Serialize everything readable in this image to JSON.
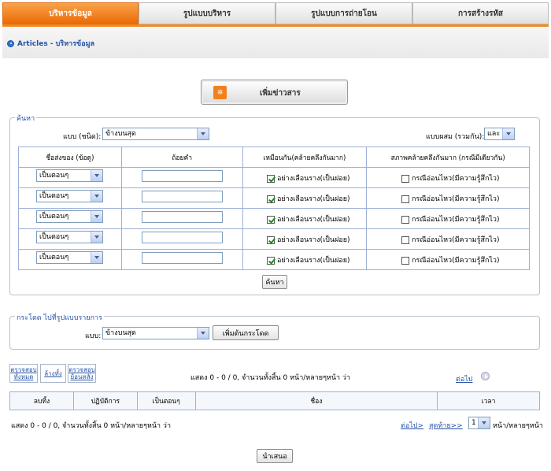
{
  "tabs": [
    {
      "label": "บริหารข้อมูล",
      "active": true
    },
    {
      "label": "รูปแบบบริหาร",
      "active": false
    },
    {
      "label": "รูปแบบการถ่ายโอน",
      "active": false
    },
    {
      "label": "การสร้างรหัส",
      "active": false
    }
  ],
  "breadcrumb": "Articles - บริหารข้อมูล",
  "add_button": "เพิ่มข่าวสาร",
  "search": {
    "legend": "ค้นหา",
    "type_label": "แบบ (ชนิด):",
    "type_value": "ข้างบนสุด",
    "combine_label": "แบบผสม (รวมกัน):",
    "combine_value": "และ",
    "headers": [
      "ชื่อส่งของ (ข้อดู)",
      "ถ้อยคำ",
      "เหมือนกัน(คล้ายคลึงกันมาก)",
      "สภาพคล้ายคลึงกันมาก (กรณีมีเดียวกัน)"
    ],
    "rows": [
      {
        "field": "เป็นตอนๆ",
        "value": "",
        "similar": "อย่างเลือนราง(เป็นฝอย)",
        "similar_checked": true,
        "case": "กรณีอ่อนไหว(มีความรู้สึกไว)",
        "case_checked": false
      },
      {
        "field": "เป็นตอนๆ",
        "value": "",
        "similar": "อย่างเลือนราง(เป็นฝอย)",
        "similar_checked": true,
        "case": "กรณีอ่อนไหว(มีความรู้สึกไว)",
        "case_checked": false
      },
      {
        "field": "เป็นตอนๆ",
        "value": "",
        "similar": "อย่างเลือนราง(เป็นฝอย)",
        "similar_checked": true,
        "case": "กรณีอ่อนไหว(มีความรู้สึกไว)",
        "case_checked": false
      },
      {
        "field": "เป็นตอนๆ",
        "value": "",
        "similar": "อย่างเลือนราง(เป็นฝอย)",
        "similar_checked": true,
        "case": "กรณีอ่อนไหว(มีความรู้สึกไว)",
        "case_checked": false
      },
      {
        "field": "เป็นตอนๆ",
        "value": "",
        "similar": "อย่างเลือนราง(เป็นฝอย)",
        "similar_checked": true,
        "case": "กรณีอ่อนไหว(มีความรู้สึกไว)",
        "case_checked": false
      }
    ],
    "search_button": "ค้นหา"
  },
  "jump": {
    "legend": "กระโดด ไปที่รูปแบบรายการ",
    "type_label": "แบบ:",
    "type_value": "ข้างบนสุด",
    "add_jump_button": "เพิ่มต้นกระโดด"
  },
  "list": {
    "check_all": "ตรวจสอบทั้งหมด",
    "clear_all": "ล้างทั้ง",
    "check_reverse": "ตรวจสอบย้อนหลัง",
    "summary": "แสดง 0 - 0 / 0, จำนวนทั้งสิ้น 0 หน้า/หลายๆหน้า ว่า",
    "next_top": "ต่อไป",
    "columns": [
      "ลบทิ้ง",
      "ปฏิบัติการ",
      "เป็นตอนๆ",
      "ชื่อง",
      "เวลา"
    ],
    "footer_summary": "แสดง 0 - 0 / 0, จำนวนทั้งสิ้น 0 หน้า/หลายๆหน้า ว่า",
    "next_link": "ต่อไป>",
    "last_link": "สุดท้าย>>",
    "page_value": "1",
    "per_page_label": "หน้า/หลายๆหน้า"
  },
  "submit_button": "นำเสนอ",
  "colors": {
    "accent": "#f08a24",
    "link": "#2653a8",
    "border": "#9db0d8"
  }
}
